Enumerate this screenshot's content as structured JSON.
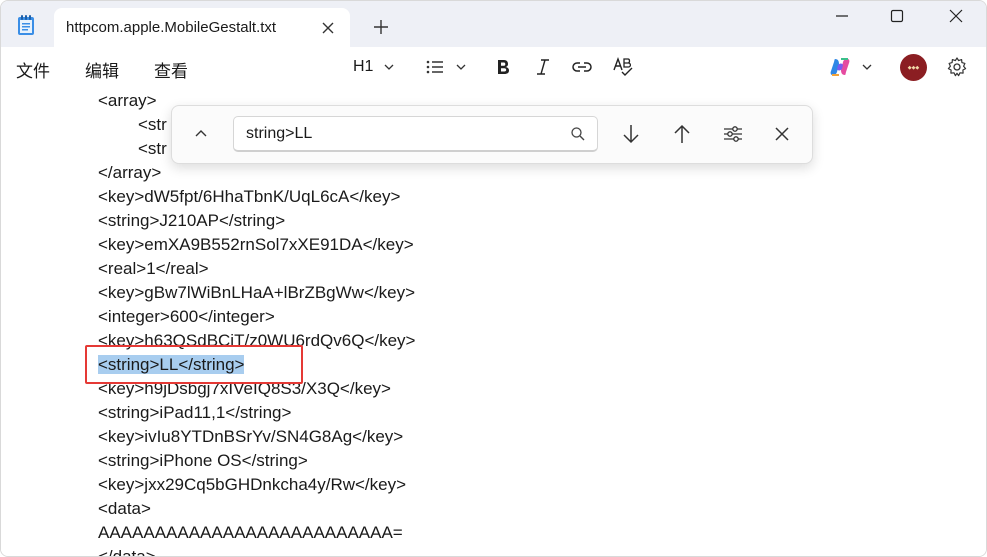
{
  "app": {
    "tab_title": "httpcom.apple.MobileGestalt.txt",
    "icons": {
      "app": "notepad-icon",
      "tab_close": "close-icon",
      "new_tab": "plus-icon",
      "minimize": "minimize-icon",
      "maximize": "maximize-icon",
      "close": "close-icon"
    }
  },
  "menu": {
    "file": "文件",
    "edit": "编辑",
    "view": "查看"
  },
  "toolbar": {
    "heading": "H1",
    "icons": [
      "chevron-down-icon",
      "list-icon",
      "bold-icon",
      "italic-icon",
      "link-icon",
      "spellcheck-icon",
      "copilot-icon",
      "avatar",
      "gear-icon"
    ]
  },
  "find": {
    "query": "string>LL",
    "icons": [
      "chevron-up-icon",
      "search-icon",
      "arrow-down-icon",
      "arrow-up-icon",
      "options-icon",
      "close-icon"
    ]
  },
  "editor": {
    "lines": [
      "<array>",
      "<str",
      "<str",
      "</array>",
      "<key>dW5fpt/6HhaTbnK/UqL6cA</key>",
      "<string>J210AP</string>",
      "<key>emXA9B552rnSol7xXE91DA</key>",
      "<real>1</real>",
      "<key>gBw7lWiBnLHaA+lBrZBgWw</key>",
      "<integer>600</integer>",
      "<key>h63QSdBCiT/z0WU6rdQv6Q</key>",
      "<string>LL</string>",
      "<key>h9jDsbgj7xIVeIQ8S3/X3Q</key>",
      "<string>iPad11,1</string>",
      "<key>ivIu8YTDnBSrYv/SN4G8Ag</key>",
      "<string>iPhone OS</string>",
      "<key>jxx29Cq5bGHDnkcha4y/Rw</key>",
      "<data>",
      "AAAAAAAAAAAAAAAAAAAAAAAAAA=",
      "</data>"
    ]
  },
  "colors": {
    "selection": "#a8cdef",
    "annotation_box": "#e53935",
    "titlebar": "#eef0f6"
  }
}
